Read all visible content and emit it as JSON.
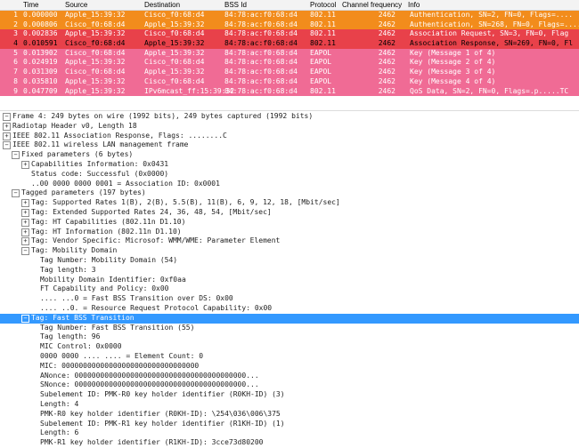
{
  "columns": {
    "no": "",
    "time": "Time",
    "source": "Source",
    "destination": "Destination",
    "bssid": "BSS Id",
    "protocol": "Protocol",
    "channel": "Channel frequency",
    "info": "Info"
  },
  "colors": {
    "orange": "#f28c1c",
    "red": "#e8414a",
    "pink": "#f06b95",
    "selected": "#e8414a",
    "tree_highlight": "#3399ff"
  },
  "packets": [
    {
      "no": "1",
      "time": "0.000000",
      "source": "Apple_15:39:32",
      "destination": "Cisco_f0:68:d4",
      "bssid": "84:78:ac:f0:68:d4",
      "protocol": "802.11",
      "channel": "2462",
      "info": "Authentication, SN=2, FN=0, Flags=....",
      "color": "orange"
    },
    {
      "no": "2",
      "time": "0.000806",
      "source": "Cisco_f0:68:d4",
      "destination": "Apple_15:39:32",
      "bssid": "84:78:ac:f0:68:d4",
      "protocol": "802.11",
      "channel": "2462",
      "info": "Authentication, SN=268, FN=0, Flags=....",
      "color": "orange"
    },
    {
      "no": "3",
      "time": "0.002836",
      "source": "Apple_15:39:32",
      "destination": "Cisco_f0:68:d4",
      "bssid": "84:78:ac:f0:68:d4",
      "protocol": "802.11",
      "channel": "2462",
      "info": "Association Request, SN=3, FN=0, Flag",
      "color": "red"
    },
    {
      "no": "4",
      "time": "0.010591",
      "source": "Cisco_f0:68:d4",
      "destination": "Apple_15:39:32",
      "bssid": "84:78:ac:f0:68:d4",
      "protocol": "802.11",
      "channel": "2462",
      "info": "Association Response, SN=269, FN=0, Fl",
      "color": "selected"
    },
    {
      "no": "5",
      "time": "0.013902",
      "source": "Cisco_f0:68:d4",
      "destination": "Apple_15:39:32",
      "bssid": "84:78:ac:f0:68:d4",
      "protocol": "EAPOL",
      "channel": "2462",
      "info": "Key (Message 1 of 4)",
      "color": "pink"
    },
    {
      "no": "6",
      "time": "0.024919",
      "source": "Apple_15:39:32",
      "destination": "Cisco_f0:68:d4",
      "bssid": "84:78:ac:f0:68:d4",
      "protocol": "EAPOL",
      "channel": "2462",
      "info": "Key (Message 2 of 4)",
      "color": "pink"
    },
    {
      "no": "7",
      "time": "0.031309",
      "source": "Cisco_f0:68:d4",
      "destination": "Apple_15:39:32",
      "bssid": "84:78:ac:f0:68:d4",
      "protocol": "EAPOL",
      "channel": "2462",
      "info": "Key (Message 3 of 4)",
      "color": "pink"
    },
    {
      "no": "8",
      "time": "0.035810",
      "source": "Apple_15:39:32",
      "destination": "Cisco_f0:68:d4",
      "bssid": "84:78:ac:f0:68:d4",
      "protocol": "EAPOL",
      "channel": "2462",
      "info": "Key (Message 4 of 4)",
      "color": "pink"
    },
    {
      "no": "9",
      "time": "0.047709",
      "source": "Apple_15:39:32",
      "destination": "IPv6mcast_ff:15:39:32",
      "bssid": "84:78:ac:f0:68:d4",
      "protocol": "802.11",
      "channel": "2462",
      "info": "QoS Data, SN=2, FN=0, Flags=.p.....TC",
      "color": "pink"
    }
  ],
  "tree": [
    {
      "level": 0,
      "toggle": "⊟",
      "text": "Frame 4: 249 bytes on wire (1992 bits), 249 bytes captured (1992 bits)"
    },
    {
      "level": 0,
      "toggle": "⊞",
      "text": "Radiotap Header v0, Length 18"
    },
    {
      "level": 0,
      "toggle": "⊞",
      "text": "IEEE 802.11 Association Response, Flags: ........C"
    },
    {
      "level": 0,
      "toggle": "⊟",
      "text": "IEEE 802.11 wireless LAN management frame"
    },
    {
      "level": 1,
      "toggle": "⊟",
      "text": "Fixed parameters (6 bytes)"
    },
    {
      "level": 2,
      "toggle": "⊞",
      "text": "Capabilities Information: 0x0431"
    },
    {
      "level": 2,
      "toggle": "",
      "text": "Status code: Successful (0x0000)"
    },
    {
      "level": 2,
      "toggle": "",
      "text": "..00 0000 0000 0001 = Association ID: 0x0001"
    },
    {
      "level": 1,
      "toggle": "⊟",
      "text": "Tagged parameters (197 bytes)"
    },
    {
      "level": 2,
      "toggle": "⊞",
      "text": "Tag: Supported Rates 1(B), 2(B), 5.5(B), 11(B), 6, 9, 12, 18, [Mbit/sec]"
    },
    {
      "level": 2,
      "toggle": "⊞",
      "text": "Tag: Extended Supported Rates 24, 36, 48, 54, [Mbit/sec]"
    },
    {
      "level": 2,
      "toggle": "⊞",
      "text": "Tag: HT Capabilities (802.11n D1.10)"
    },
    {
      "level": 2,
      "toggle": "⊞",
      "text": "Tag: HT Information (802.11n D1.10)"
    },
    {
      "level": 2,
      "toggle": "⊞",
      "text": "Tag: Vendor Specific: Microsof: WMM/WME: Parameter Element"
    },
    {
      "level": 2,
      "toggle": "⊟",
      "text": "Tag: Mobility Domain"
    },
    {
      "level": 3,
      "toggle": "",
      "text": "Tag Number: Mobility Domain (54)"
    },
    {
      "level": 3,
      "toggle": "",
      "text": "Tag length: 3"
    },
    {
      "level": 3,
      "toggle": "",
      "text": "Mobility Domain Identifier: 0xf0aa"
    },
    {
      "level": 3,
      "toggle": "",
      "text": "FT Capability and Policy: 0x00"
    },
    {
      "level": 3,
      "toggle": "",
      "text": ".... ...0 = Fast BSS Transition over DS: 0x00"
    },
    {
      "level": 3,
      "toggle": "",
      "text": ".... ..0. = Resource Request Protocol Capability: 0x00"
    },
    {
      "level": 2,
      "toggle": "⊟",
      "text": "Tag: Fast BSS Transition",
      "highlight": true
    },
    {
      "level": 3,
      "toggle": "",
      "text": "Tag Number: Fast BSS Transition (55)"
    },
    {
      "level": 3,
      "toggle": "",
      "text": "Tag length: 96"
    },
    {
      "level": 3,
      "toggle": "",
      "text": "MIC Control: 0x0000"
    },
    {
      "level": 3,
      "toggle": "",
      "text": "0000 0000 .... .... = Element Count: 0"
    },
    {
      "level": 3,
      "toggle": "",
      "text": "MIC: 00000000000000000000000000000000"
    },
    {
      "level": 3,
      "toggle": "",
      "text": "ANonce: 0000000000000000000000000000000000000000..."
    },
    {
      "level": 3,
      "toggle": "",
      "text": "SNonce: 0000000000000000000000000000000000000000..."
    },
    {
      "level": 3,
      "toggle": "",
      "text": "Subelement ID: PMK-R0 key holder identifier (R0KH-ID) (3)"
    },
    {
      "level": 3,
      "toggle": "",
      "text": "Length: 4"
    },
    {
      "level": 3,
      "toggle": "",
      "text": "PMK-R0 key holder identifier (R0KH-ID): \\254\\036\\006\\375"
    },
    {
      "level": 3,
      "toggle": "",
      "text": "Subelement ID: PMK-R1 key holder identifier (R1KH-ID) (1)"
    },
    {
      "level": 3,
      "toggle": "",
      "text": "Length: 6"
    },
    {
      "level": 3,
      "toggle": "",
      "text": "PMK-R1 key holder identifier (R1KH-ID): 3cce73d80200"
    }
  ]
}
